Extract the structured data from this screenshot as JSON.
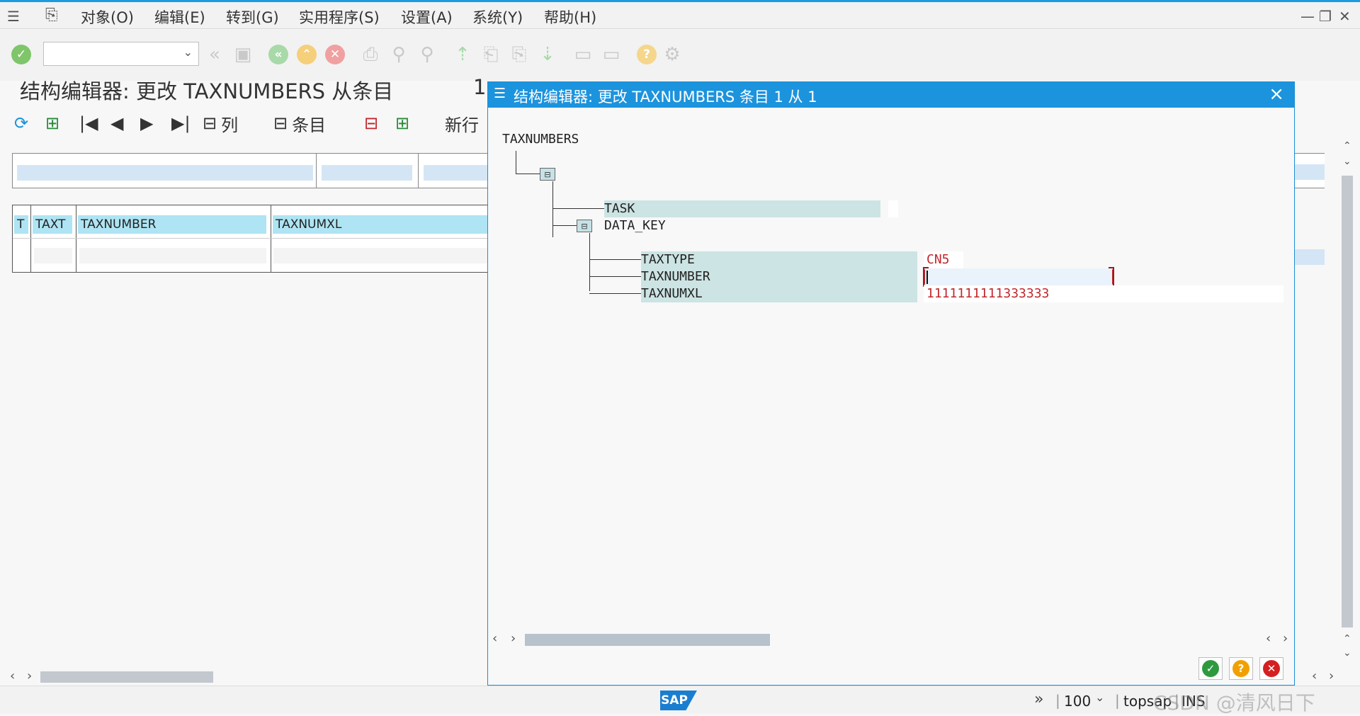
{
  "menu": {
    "items": [
      "对象(O)",
      "编辑(E)",
      "转到(G)",
      "实用程序(S)",
      "设置(A)",
      "系统(Y)",
      "帮助(H)"
    ]
  },
  "window_controls": {
    "minimize": "—",
    "restore": "❐",
    "close": "✕"
  },
  "command_field": {
    "value": ""
  },
  "page": {
    "title": "结构编辑器: 更改 TAXNUMBERS 从条目",
    "title_num": "1"
  },
  "app_toolbar": {
    "columns_label": "列",
    "entries_label": "条目",
    "new_row_label": "新行"
  },
  "grid": {
    "headers": [
      "T",
      "TAXT",
      "TAXNUMBER",
      "TAXNUMXL"
    ]
  },
  "dialog": {
    "title": "结构编辑器: 更改 TAXNUMBERS 条目 1 从 1",
    "root": "TAXNUMBERS",
    "fields": {
      "task": "TASK",
      "data_key": "DATA_KEY",
      "taxtype": "TAXTYPE",
      "taxnumber": "TAXNUMBER",
      "taxnumxl": "TAXNUMXL"
    },
    "values": {
      "taxtype": "CN5",
      "taxnumber": "",
      "taxnumxl": "1111111111333333"
    }
  },
  "status": {
    "zoom": "100",
    "system": "topsap",
    "mode": "INS",
    "watermark": "CSDN @清风日下"
  },
  "colors": {
    "accent": "#1c93dd",
    "value_red": "#c0282d",
    "header_cyan": "#aee4f3"
  }
}
